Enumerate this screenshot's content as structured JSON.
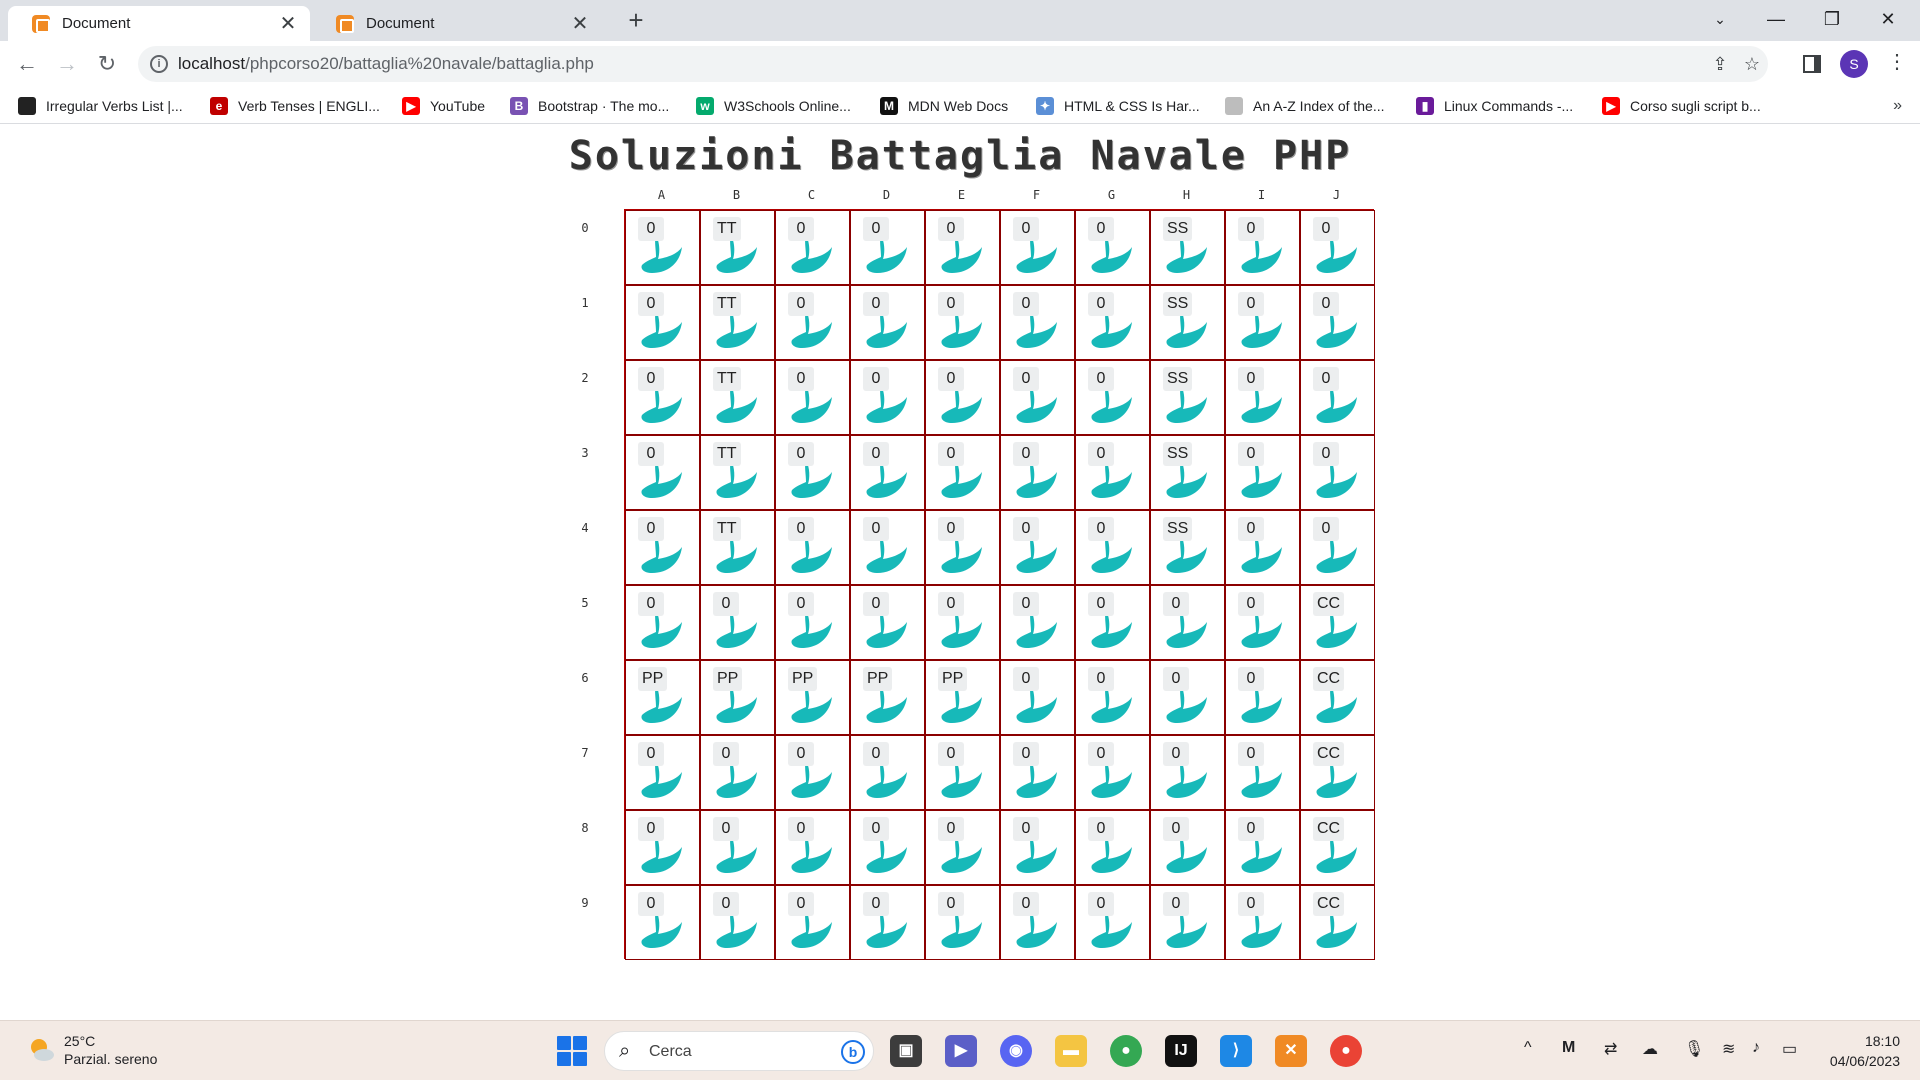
{
  "browser": {
    "tabs": [
      {
        "title": "Document",
        "active": true
      },
      {
        "title": "Document",
        "active": false
      }
    ],
    "url_host": "localhost",
    "url_path": "/phpcorso20/battaglia%20navale/battaglia.php",
    "profile_initial": "S",
    "bookmarks": [
      {
        "label": "Irregular Verbs List |...",
        "icon": "dict-icon",
        "color": "#222222"
      },
      {
        "label": "Verb Tenses | ENGLI...",
        "icon": "e-icon",
        "color": "#c00000"
      },
      {
        "label": "YouTube",
        "icon": "youtube-icon",
        "color": "#ff0000"
      },
      {
        "label": "Bootstrap · The mo...",
        "icon": "bootstrap-icon",
        "color": "#7952b3"
      },
      {
        "label": "W3Schools Online...",
        "icon": "w3schools-icon",
        "color": "#04aa6d"
      },
      {
        "label": "MDN Web Docs",
        "icon": "mdn-icon",
        "color": "#111111"
      },
      {
        "label": "HTML & CSS Is Har...",
        "icon": "htmlcss-icon",
        "color": "#5b8fd6"
      },
      {
        "label": "An A-Z Index of the...",
        "icon": "ss64-icon",
        "color": "#bdbdbd"
      },
      {
        "label": "Linux Commands -...",
        "icon": "linux-icon",
        "color": "#6a1b9a"
      },
      {
        "label": "Corso sugli script b...",
        "icon": "youtube-icon",
        "color": "#ff0000"
      }
    ]
  },
  "page": {
    "title": "Soluzioni Battaglia Navale PHP",
    "col_headers": [
      "A",
      "B",
      "C",
      "D",
      "E",
      "F",
      "G",
      "H",
      "I",
      "J"
    ],
    "row_headers": [
      "0",
      "1",
      "2",
      "3",
      "4",
      "5",
      "6",
      "7",
      "8",
      "9"
    ],
    "grid": [
      [
        "0",
        "TT",
        "0",
        "0",
        "0",
        "0",
        "0",
        "SS",
        "0",
        "0"
      ],
      [
        "0",
        "TT",
        "0",
        "0",
        "0",
        "0",
        "0",
        "SS",
        "0",
        "0"
      ],
      [
        "0",
        "TT",
        "0",
        "0",
        "0",
        "0",
        "0",
        "SS",
        "0",
        "0"
      ],
      [
        "0",
        "TT",
        "0",
        "0",
        "0",
        "0",
        "0",
        "SS",
        "0",
        "0"
      ],
      [
        "0",
        "TT",
        "0",
        "0",
        "0",
        "0",
        "0",
        "SS",
        "0",
        "0"
      ],
      [
        "0",
        "0",
        "0",
        "0",
        "0",
        "0",
        "0",
        "0",
        "0",
        "CC"
      ],
      [
        "PP",
        "PP",
        "PP",
        "PP",
        "PP",
        "0",
        "0",
        "0",
        "0",
        "CC"
      ],
      [
        "0",
        "0",
        "0",
        "0",
        "0",
        "0",
        "0",
        "0",
        "0",
        "CC"
      ],
      [
        "0",
        "0",
        "0",
        "0",
        "0",
        "0",
        "0",
        "0",
        "0",
        "CC"
      ],
      [
        "0",
        "0",
        "0",
        "0",
        "0",
        "0",
        "0",
        "0",
        "0",
        "CC"
      ]
    ],
    "wave_color": "#17b9b9",
    "grid_border_color": "#8b0000"
  },
  "taskbar": {
    "weather_temp": "25°C",
    "weather_desc": "Parzial. sereno",
    "search_placeholder": "Cerca",
    "apps": [
      "task-view-icon",
      "meet-icon",
      "discord-icon",
      "file-explorer-icon",
      "chrome-icon",
      "intellij-icon",
      "vscode-icon",
      "xampp-icon",
      "chrome-profile-icon"
    ],
    "time": "18:10",
    "date": "04/06/2023"
  }
}
